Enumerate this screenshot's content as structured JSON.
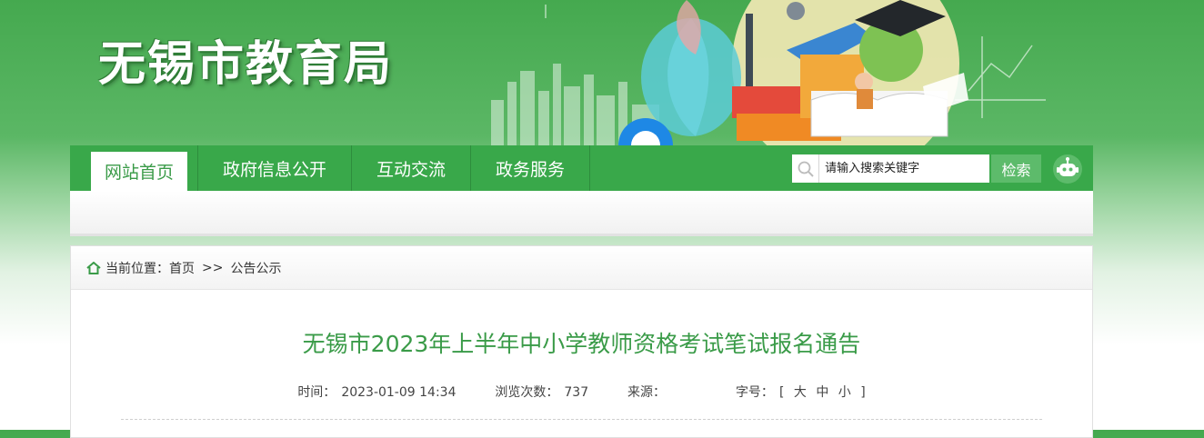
{
  "site": {
    "title": "无锡市教育局"
  },
  "nav": {
    "items": [
      {
        "label": "网站首页",
        "active": true
      },
      {
        "label": "政府信息公开",
        "active": false
      },
      {
        "label": "互动交流",
        "active": false
      },
      {
        "label": "政务服务",
        "active": false
      }
    ],
    "search": {
      "placeholder": "请输入搜索关键字",
      "button": "检索"
    }
  },
  "breadcrumb": {
    "prefix": "当前位置：",
    "home": "首页",
    "separator": ">>",
    "current": "公告公示"
  },
  "article": {
    "title": "无锡市2023年上半年中小学教师资格考试笔试报名通告",
    "time_label": "时间：",
    "time_value": "2023-01-09 14:34",
    "views_label": "浏览次数：",
    "views_value": "737",
    "source_label": "来源：",
    "source_value": "",
    "fontsize_label": "字号：",
    "fontsize_open": "[",
    "fontsize_large": "大",
    "fontsize_medium": "中",
    "fontsize_small": "小",
    "fontsize_close": "]"
  },
  "colors": {
    "brand_green": "#39a84a",
    "title_green": "#3a9b48",
    "search_button": "#5dbb6b"
  }
}
